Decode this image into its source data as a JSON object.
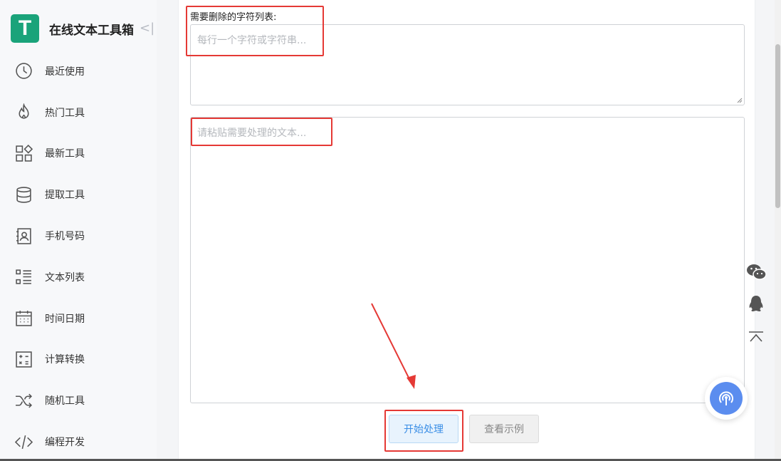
{
  "brand": {
    "logo_letter": "T",
    "name": "在线文本工具箱",
    "collapse": "<|"
  },
  "nav": [
    {
      "label": "最近使用",
      "icon": "clock-icon"
    },
    {
      "label": "热门工具",
      "icon": "flame-icon"
    },
    {
      "label": "最新工具",
      "icon": "shapes-icon"
    },
    {
      "label": "提取工具",
      "icon": "database-icon"
    },
    {
      "label": "手机号码",
      "icon": "contact-card-icon"
    },
    {
      "label": "文本列表",
      "icon": "list-icon"
    },
    {
      "label": "时间日期",
      "icon": "calendar-icon"
    },
    {
      "label": "计算转换",
      "icon": "calculator-icon"
    },
    {
      "label": "随机工具",
      "icon": "shuffle-icon"
    },
    {
      "label": "编程开发",
      "icon": "code-icon"
    }
  ],
  "form": {
    "chars_label": "需要删除的字符列表:",
    "chars_placeholder": "每行一个字符或字符串...",
    "text_placeholder": "请粘贴需要处理的文本...",
    "start_button": "开始处理",
    "example_button": "查看示例"
  },
  "float_icons": [
    "wechat-icon",
    "qq-icon",
    "back-to-top-icon",
    "broadcast-icon"
  ],
  "colors": {
    "brand": "#1aa37a",
    "primary": "#3a8ee6",
    "annotation": "#e53935",
    "fab": "#5b8def"
  }
}
